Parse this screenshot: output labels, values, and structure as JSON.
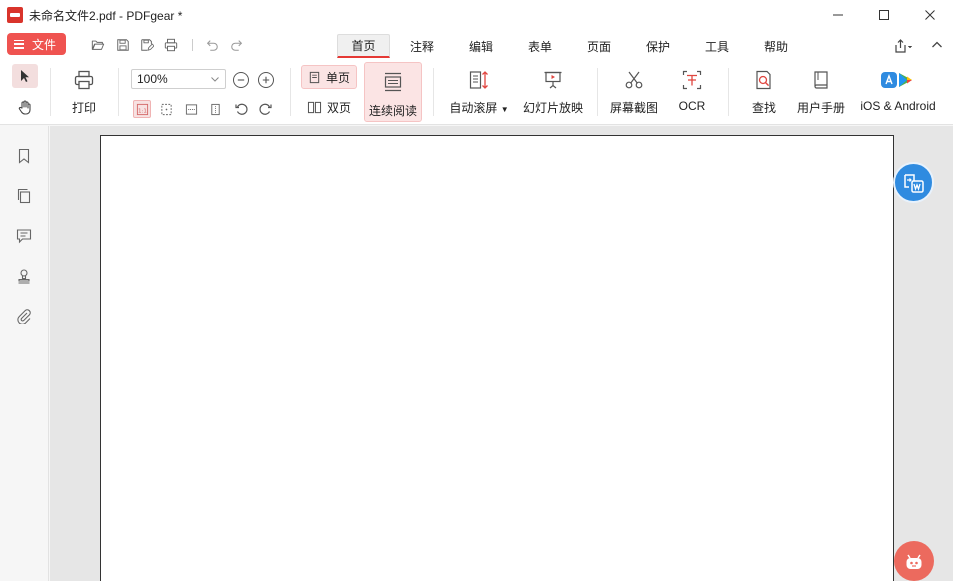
{
  "window": {
    "title": "未命名文件2.pdf - PDFgear *"
  },
  "menu": {
    "file_label": "文件",
    "tabs": [
      {
        "label": "首页",
        "active": true
      },
      {
        "label": "注释"
      },
      {
        "label": "编辑"
      },
      {
        "label": "表单"
      },
      {
        "label": "页面"
      },
      {
        "label": "保护"
      },
      {
        "label": "工具"
      },
      {
        "label": "帮助"
      }
    ]
  },
  "ribbon": {
    "print_label": "打印",
    "zoom_value": "100%",
    "single_page_label": "单页",
    "double_page_label": "双页",
    "continuous_label": "连续阅读",
    "auto_scroll_label": "自动滚屏",
    "slideshow_label": "幻灯片放映",
    "screenshot_label": "屏幕截图",
    "ocr_label": "OCR",
    "find_label": "查找",
    "manual_label": "用户手册",
    "mobile_label": "iOS & Android"
  },
  "colors": {
    "accent": "#ef5350",
    "active_bg": "#fbe4e4",
    "float_word": "#2f8be0",
    "float_ai": "#ec6a5e"
  },
  "icons": {
    "sidebar": [
      "bookmark-icon",
      "pages-icon",
      "comment-icon",
      "stamp-icon",
      "attachment-icon"
    ]
  }
}
